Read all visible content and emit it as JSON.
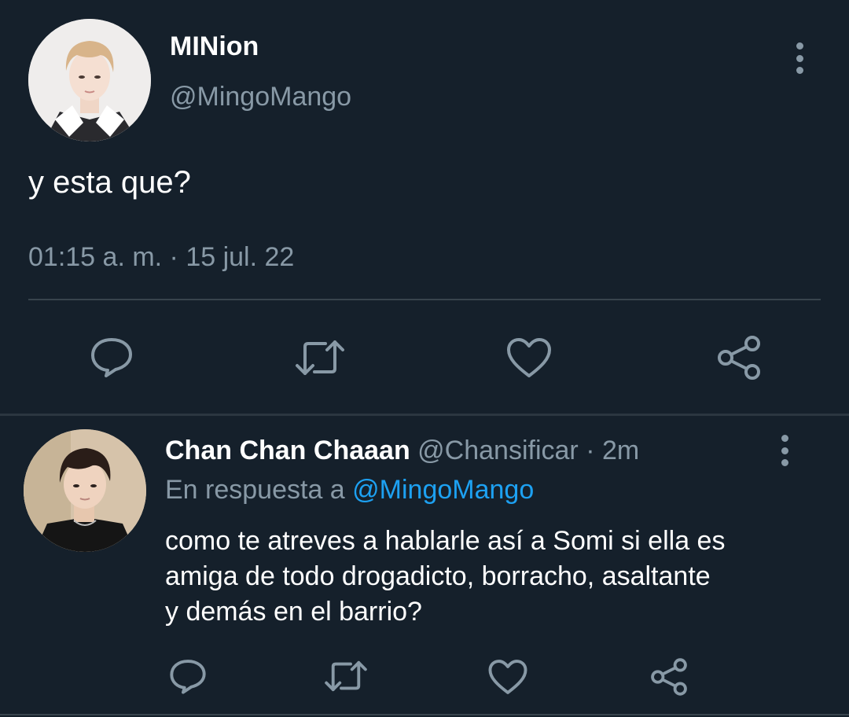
{
  "main_tweet": {
    "display_name": "MINion",
    "handle": "@MingoMango",
    "text": "y esta que?",
    "timestamp": "01:15 a. m. · 15 jul. 22",
    "actions": [
      "reply-icon",
      "retweet-icon",
      "like-icon",
      "share-icon"
    ]
  },
  "reply_tweet": {
    "display_name": "Chan Chan Chaaan",
    "handle": "@Chansificar",
    "separator": "·",
    "time": "2m",
    "replying_to_label": "En respuesta a",
    "replying_to_handle": "@MingoMango",
    "text_lines": [
      "como te atreves a hablarle así a Somi si ella es",
      "amiga de todo drogadicto, borracho, asaltante",
      "y demás en el barrio?"
    ],
    "actions": [
      "reply-icon",
      "retweet-icon",
      "like-icon",
      "share-icon"
    ]
  },
  "colors": {
    "background": "#15202b",
    "text_primary": "#ffffff",
    "text_secondary": "#8899a6",
    "link": "#1da1f2",
    "divider": "#38444d"
  }
}
